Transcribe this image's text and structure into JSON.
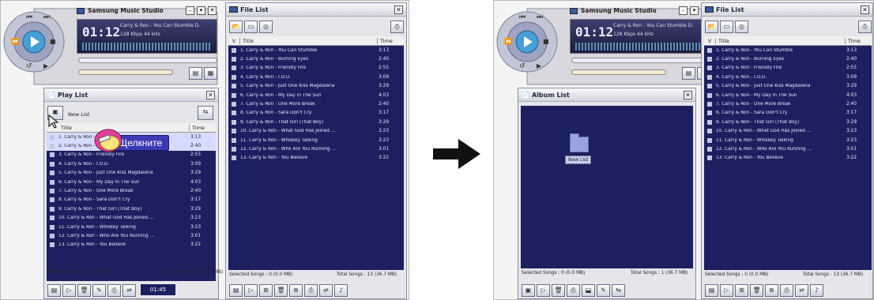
{
  "player": {
    "title": "Samsung Music Studio",
    "time": "01:12",
    "track_line": "Carry & Ron - You Can Stumble D.",
    "info": "128 Kbps  44 kHz"
  },
  "player_right": {
    "track_line": "Carry & Ron - You Can Stumble D."
  },
  "file_list": {
    "title": "File List",
    "col_check": "V",
    "col_title": "Title",
    "col_time": "Time",
    "rows": [
      {
        "t": "1. Carry & Ron - You Can Stumble",
        "d": "3:13"
      },
      {
        "t": "2. Carry & Ron - Burning Eyes",
        "d": "2:40"
      },
      {
        "t": "3. Carry & Ron - Friendly Fire",
        "d": "2:55"
      },
      {
        "t": "4. Carry & Ron - I.O.U.",
        "d": "3:09"
      },
      {
        "t": "5. Carry & Ron - Just One Kiss Magdalena",
        "d": "3:29"
      },
      {
        "t": "6. Carry & Ron - My Day In The Sun",
        "d": "4:03"
      },
      {
        "t": "7. Carry & Ron - One More Break",
        "d": "2:40"
      },
      {
        "t": "8. Carry & Ron - Sara Don't Cry",
        "d": "3:17"
      },
      {
        "t": "9. Carry & Ron - That Girl (That Boy)",
        "d": "3:29"
      },
      {
        "t": "10. Carry & Ron - What God Has Joined ...",
        "d": "3:23"
      },
      {
        "t": "11. Carry & Ron - Whiskey Talking",
        "d": "3:23"
      },
      {
        "t": "12. Carry & Ron - Who Are You Running ...",
        "d": "3:01"
      },
      {
        "t": "13. Carry & Ron - You Believe",
        "d": "3:22"
      }
    ],
    "footer_left": "Selected Songs : 0 (0.0 MB)",
    "footer_right": "Total Songs : 13 (36.7 MB)"
  },
  "play_list": {
    "title": "Play List",
    "new_list": "New List",
    "col_title": "Title",
    "col_time": "Time",
    "rows": [
      {
        "t": "1. Carry & Ron - You Can Stumble",
        "d": "3:13"
      },
      {
        "t": "2. Carry & Ron - Burning Eyes",
        "d": "2:40"
      },
      {
        "t": "3. Carry & Ron - Friendly Fire",
        "d": "2:55"
      },
      {
        "t": "4. Carry & Ron - I.O.U.",
        "d": "3:09"
      },
      {
        "t": "5. Carry & Ron - Just One Kiss Magdalena",
        "d": "3:29"
      },
      {
        "t": "6. Carry & Ron - My Day In The Sun",
        "d": "4:03"
      },
      {
        "t": "7. Carry & Ron - One More Break",
        "d": "2:40"
      },
      {
        "t": "8. Carry & Ron - Sara Don't Cry",
        "d": "3:17"
      },
      {
        "t": "9. Carry & Ron - That Girl (That Boy)",
        "d": "3:29"
      },
      {
        "t": "10. Carry & Ron - What God Has Joined ...",
        "d": "3:23"
      },
      {
        "t": "11. Carry & Ron - Whiskey Talking",
        "d": "3:23"
      },
      {
        "t": "12. Carry & Ron - Who Are You Running ...",
        "d": "3:01"
      },
      {
        "t": "13. Carry & Ron - You Believe",
        "d": "3:22"
      }
    ],
    "footer_left": "Selected Songs : 0 (0.0 MB)",
    "footer_right": "Total Songs : 13 (36.7 MB)",
    "time_box": "01:45"
  },
  "album_list": {
    "title": "Album List",
    "folder_label": "New List",
    "footer_left": "Selected Songs : 0 (0.0 MB)",
    "footer_right": "Total Songs : 1 (36.7 MB)"
  },
  "callout": {
    "text": "Щелкните"
  },
  "colors": {
    "list_bg": "#1c2060",
    "panel_bg": "#e6e6ea",
    "callout_bg": "#3c3ab4"
  }
}
